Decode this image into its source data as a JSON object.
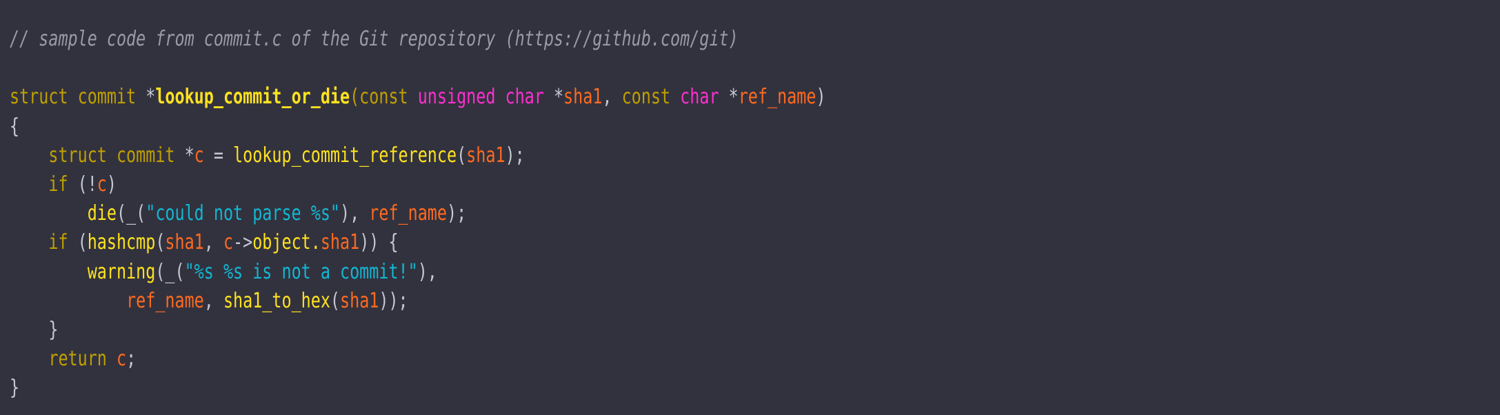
{
  "editor": {
    "background_color": "#32323e",
    "language": "C",
    "source_file": "commit.c",
    "palette": {
      "comment": "#9a9aa8",
      "keyword": "#c0a000",
      "type": "#ff2fd0",
      "function": "#ffe21f",
      "variable": "#ff6a1f",
      "string": "#11b8d4",
      "punctuation": "#c6c9d2",
      "background": "#32323e"
    },
    "lines": [
      {
        "tokens": [
          {
            "t": "// sample code from commit.c of the Git repository (https://github.com/git)",
            "c": "cm"
          }
        ]
      },
      {
        "tokens": []
      },
      {
        "tokens": [
          {
            "t": "struct commit ",
            "c": "kw"
          },
          {
            "t": "*",
            "c": "pu"
          },
          {
            "t": "lookup_commit_or_die",
            "c": "fnb"
          },
          {
            "t": "(const ",
            "c": "kw"
          },
          {
            "t": "unsigned char ",
            "c": "ty"
          },
          {
            "t": "*",
            "c": "pu"
          },
          {
            "t": "sha1",
            "c": "va"
          },
          {
            "t": ", ",
            "c": "pu"
          },
          {
            "t": "const ",
            "c": "kw"
          },
          {
            "t": "char ",
            "c": "ty"
          },
          {
            "t": "*",
            "c": "pu"
          },
          {
            "t": "ref_name",
            "c": "va"
          },
          {
            "t": ")",
            "c": "pu"
          }
        ]
      },
      {
        "tokens": [
          {
            "t": "{",
            "c": "pu"
          }
        ]
      },
      {
        "tokens": [
          {
            "t": "    ",
            "c": "pu"
          },
          {
            "t": "struct commit ",
            "c": "kw"
          },
          {
            "t": "*",
            "c": "pu"
          },
          {
            "t": "c",
            "c": "va"
          },
          {
            "t": " = ",
            "c": "pu"
          },
          {
            "t": "lookup_commit_reference",
            "c": "fn"
          },
          {
            "t": "(",
            "c": "pu"
          },
          {
            "t": "sha1",
            "c": "va"
          },
          {
            "t": ");",
            "c": "pu"
          }
        ]
      },
      {
        "tokens": [
          {
            "t": "    ",
            "c": "pu"
          },
          {
            "t": "if",
            "c": "kw"
          },
          {
            "t": " (!",
            "c": "pu"
          },
          {
            "t": "c",
            "c": "va"
          },
          {
            "t": ")",
            "c": "pu"
          }
        ]
      },
      {
        "tokens": [
          {
            "t": "        ",
            "c": "pu"
          },
          {
            "t": "die",
            "c": "fn"
          },
          {
            "t": "(_(",
            "c": "pu"
          },
          {
            "t": "\"could not parse %s\"",
            "c": "st"
          },
          {
            "t": "), ",
            "c": "pu"
          },
          {
            "t": "ref_name",
            "c": "va"
          },
          {
            "t": ");",
            "c": "pu"
          }
        ]
      },
      {
        "tokens": [
          {
            "t": "    ",
            "c": "pu"
          },
          {
            "t": "if",
            "c": "kw"
          },
          {
            "t": " (",
            "c": "pu"
          },
          {
            "t": "hashcmp",
            "c": "fn"
          },
          {
            "t": "(",
            "c": "pu"
          },
          {
            "t": "sha1",
            "c": "va"
          },
          {
            "t": ", ",
            "c": "pu"
          },
          {
            "t": "c",
            "c": "va"
          },
          {
            "t": "->",
            "c": "pu"
          },
          {
            "t": "object",
            "c": "fn"
          },
          {
            "t": ".",
            "c": "fn"
          },
          {
            "t": "sha1",
            "c": "va"
          },
          {
            "t": ")) {",
            "c": "pu"
          }
        ]
      },
      {
        "tokens": [
          {
            "t": "        ",
            "c": "pu"
          },
          {
            "t": "warning",
            "c": "fn"
          },
          {
            "t": "(_(",
            "c": "pu"
          },
          {
            "t": "\"%s %s is not a commit!\"",
            "c": "st"
          },
          {
            "t": "),",
            "c": "pu"
          }
        ]
      },
      {
        "tokens": [
          {
            "t": "            ",
            "c": "pu"
          },
          {
            "t": "ref_name",
            "c": "va"
          },
          {
            "t": ", ",
            "c": "pu"
          },
          {
            "t": "sha1_to_hex",
            "c": "fn"
          },
          {
            "t": "(",
            "c": "pu"
          },
          {
            "t": "sha1",
            "c": "va"
          },
          {
            "t": "));",
            "c": "pu"
          }
        ]
      },
      {
        "tokens": [
          {
            "t": "    }",
            "c": "pu"
          }
        ]
      },
      {
        "tokens": [
          {
            "t": "    ",
            "c": "pu"
          },
          {
            "t": "return",
            "c": "kw"
          },
          {
            "t": " ",
            "c": "pu"
          },
          {
            "t": "c",
            "c": "va"
          },
          {
            "t": ";",
            "c": "pu"
          }
        ]
      },
      {
        "tokens": [
          {
            "t": "}",
            "c": "pu"
          }
        ]
      }
    ]
  }
}
